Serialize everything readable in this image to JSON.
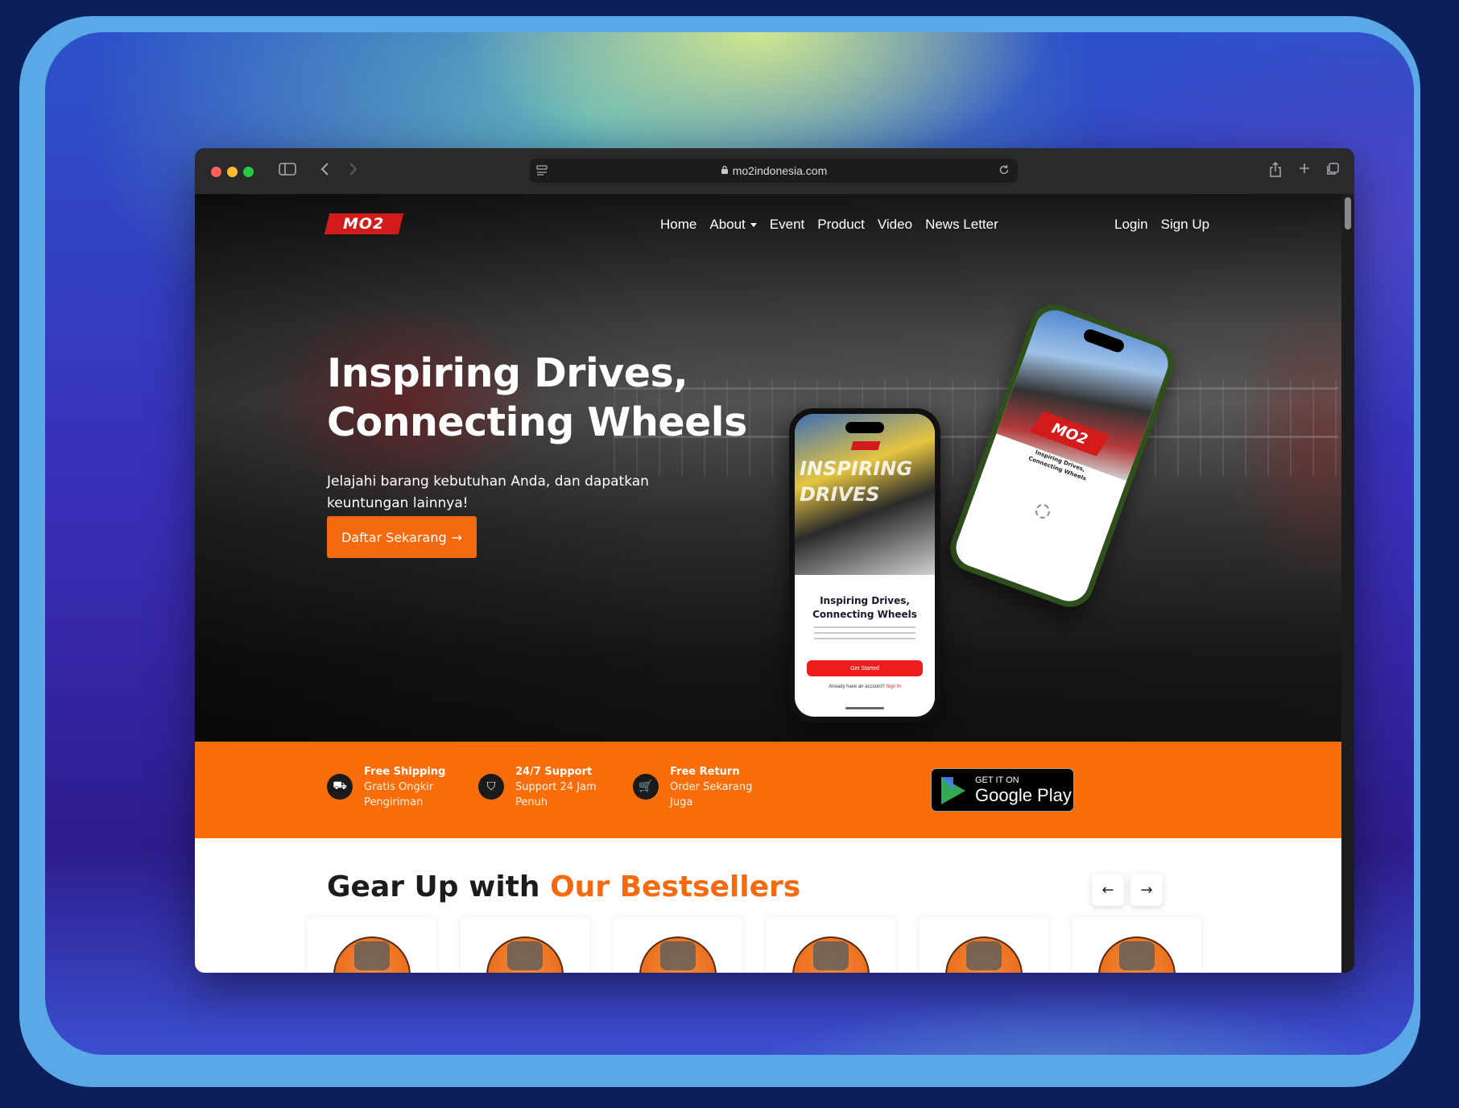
{
  "browser": {
    "url": "mo2indonesia.com"
  },
  "site": {
    "logo_text": "MO2",
    "nav": {
      "home": "Home",
      "about": "About",
      "event": "Event",
      "product": "Product",
      "video": "Video",
      "newsletter": "News Letter",
      "login": "Login",
      "signup": "Sign Up"
    },
    "hero": {
      "title_line1": "Inspiring Drives,",
      "title_line2": "Connecting Wheels",
      "subtitle": "Jelajahi barang kebutuhan Anda, dan dapatkan keuntungan lainnya!",
      "cta_label": "Daftar Sekarang",
      "cta_arrow": "→"
    },
    "phone_front": {
      "photo_text": "INSPIRING DRIVES",
      "title_line1": "Inspiring Drives,",
      "title_line2": "Connecting Wheels",
      "button": "Get Started",
      "footer_text": "Already have an account?",
      "footer_link": "Sign In"
    },
    "phone_back": {
      "logo_text": "MO2",
      "tagline_line1": "Inspiring Drives,",
      "tagline_line2": "Connecting Wheels"
    },
    "features": [
      {
        "title": "Free Shipping",
        "line1": "Gratis Ongkir",
        "line2": "Pengiriman",
        "icon": "truck-icon",
        "glyph": "⛟"
      },
      {
        "title": "24/7 Support",
        "line1": "Support 24 Jam",
        "line2": "Penuh",
        "icon": "shield-icon",
        "glyph": "⛉"
      },
      {
        "title": "Free Return",
        "line1": "Order Sekarang",
        "line2": "Juga",
        "icon": "cart-icon",
        "glyph": "🛒"
      }
    ],
    "google_play": {
      "small": "GET IT ON",
      "big": "Google Play"
    },
    "bestsellers": {
      "title_prefix": "Gear Up with",
      "title_accent": "Our Bestsellers",
      "prev_arrow": "←",
      "next_arrow": "→"
    }
  },
  "colors": {
    "accent": "#f5690f",
    "feature_bar": "#fb6d0a",
    "logo_red": "#d41b1b"
  }
}
